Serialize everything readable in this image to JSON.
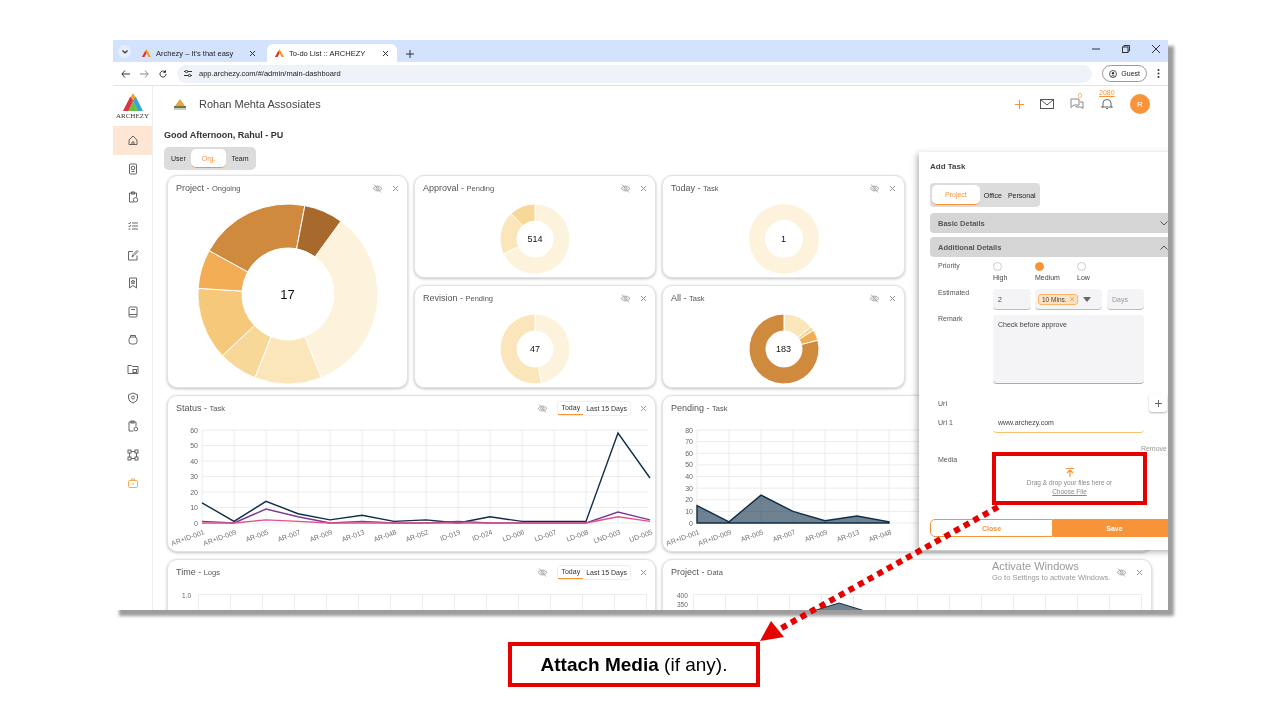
{
  "browser": {
    "tabs": [
      {
        "title": "Archezy – It's that easy",
        "selected": false
      },
      {
        "title": "To-do List :: ARCHEZY",
        "selected": true
      }
    ],
    "url": "app.archezy.com/#/admin/main-dashboard",
    "profile": "Guest"
  },
  "sidebar": {
    "logo_text": "ARCHEZY",
    "items": [
      {
        "selected": true
      },
      {
        "selected": false
      },
      {
        "selected": false
      },
      {
        "selected": false
      },
      {
        "selected": false
      },
      {
        "selected": false
      },
      {
        "selected": false
      },
      {
        "selected": false
      },
      {
        "selected": false
      },
      {
        "selected": false
      },
      {
        "selected": false
      },
      {
        "selected": false
      },
      {
        "selected": false
      }
    ]
  },
  "header": {
    "company": "Rohan Mehta Assosiates",
    "chat_count": "0",
    "notification_count": "2080",
    "avatar": "R"
  },
  "greeting": "Good Afternoon, Rahul - PU",
  "scope_tabs": [
    {
      "label": "User",
      "selected": false
    },
    {
      "label": "Org.",
      "selected": true
    },
    {
      "label": "Team",
      "selected": false
    }
  ],
  "cards": [
    {
      "kind": "donut",
      "title": "Project -",
      "subtitle": "Ongoing",
      "center": "17"
    },
    {
      "kind": "donut",
      "title": "Approval -",
      "subtitle": "Pending",
      "center": "514"
    },
    {
      "kind": "donut",
      "title": "Today -",
      "subtitle": "Task",
      "center": "1"
    },
    {
      "kind": "donut",
      "title": "Revision -",
      "subtitle": "Pending",
      "center": "47"
    },
    {
      "kind": "donut",
      "title": "All -",
      "subtitle": "Task",
      "center": "183"
    },
    {
      "kind": "line",
      "title": "Status -",
      "subtitle": "Task",
      "period_tabs": [
        {
          "label": "Today",
          "selected": true
        },
        {
          "label": "Last 15 Days",
          "selected": false
        }
      ],
      "chart_data": {
        "type": "line",
        "categories": [
          "AR+ID-001",
          "AR+ID-009",
          "AR-005",
          "AR-007",
          "AR-009",
          "AR-013",
          "AR-048",
          "AR-052",
          "ID-019",
          "ID-024",
          "LD-006",
          "LD-007",
          "LD-008",
          "LND-003",
          "UD-005"
        ],
        "grid": true,
        "ylim": [
          0,
          60
        ],
        "yticks": [
          0,
          10,
          20,
          30,
          40,
          50,
          60
        ],
        "series": [
          {
            "color": "#0f2e47",
            "values": [
              13,
              1,
              14,
              6,
              2,
              5,
              1,
              2,
              0,
              4,
              1,
              1,
              1,
              58,
              29
            ]
          },
          {
            "color": "#7a3d96",
            "values": [
              1,
              0,
              9,
              4,
              0,
              1,
              0,
              0,
              1,
              0,
              0,
              0,
              0,
              7,
              2
            ]
          },
          {
            "color": "#e0528f",
            "values": [
              0,
              0,
              2,
              1,
              0,
              0,
              0,
              0,
              0,
              0,
              0,
              0,
              0,
              4,
              1
            ]
          }
        ]
      }
    },
    {
      "kind": "line",
      "title": "Pending -",
      "subtitle": "Task",
      "controls": false,
      "chart_data": {
        "type": "area",
        "categories": [
          "AR+ID-001",
          "AR+ID-009",
          "AR-005",
          "AR-007",
          "AR-009",
          "AR-013",
          "AR-048"
        ],
        "grid": true,
        "ylim": [
          0,
          80
        ],
        "yticks": [
          0,
          10,
          20,
          30,
          40,
          50,
          60,
          70,
          80
        ],
        "series": [
          {
            "color": "#0f2e47",
            "values": [
              15,
              1,
              24,
              10,
              2,
              6,
              1
            ]
          }
        ]
      }
    },
    {
      "kind": "partial",
      "title": "Time -",
      "subtitle": "Logs",
      "period_tabs": [
        {
          "label": "Today",
          "selected": true
        },
        {
          "label": "Last 15 Days",
          "selected": false
        }
      ],
      "axis_labels": [
        "1.0"
      ]
    },
    {
      "kind": "partial",
      "title": "Project -",
      "subtitle": "Data",
      "axis_labels": [
        "400",
        "350"
      ]
    }
  ],
  "add_task": {
    "title": "Add Task",
    "tabs": [
      {
        "label": "Project",
        "selected": true
      },
      {
        "label": "Office",
        "selected": false
      },
      {
        "label": "Personal",
        "selected": false
      }
    ],
    "sections": [
      {
        "label": "Basic Details",
        "expanded": false
      },
      {
        "label": "Additional Details",
        "expanded": true
      }
    ],
    "priority": {
      "label": "Priority",
      "options": [
        {
          "label": "High",
          "selected": false
        },
        {
          "label": "Medium",
          "selected": true
        },
        {
          "label": "Low",
          "selected": false
        }
      ]
    },
    "estimated": {
      "label": "Estimated",
      "value": "2",
      "unit_chip": "10 Mins.",
      "days_placeholder": "Days"
    },
    "remark": {
      "label": "Remark",
      "value": "Check before approve"
    },
    "url_label": "Url",
    "urls": [
      {
        "label": "Url 1",
        "value": "www.archezy.com",
        "remove": "Remove"
      }
    ],
    "media": {
      "label": "Media",
      "hint": "Drag & drop your files here or",
      "link": "Choose File"
    },
    "buttons": [
      {
        "label": "Close",
        "kind": "secondary"
      },
      {
        "label": "Save",
        "kind": "primary"
      }
    ]
  },
  "os_notice": {
    "title": "Activate Windows",
    "subtitle": "Go to Settings to activate Windows."
  },
  "callout": "**Attach Media** (if any)."
}
